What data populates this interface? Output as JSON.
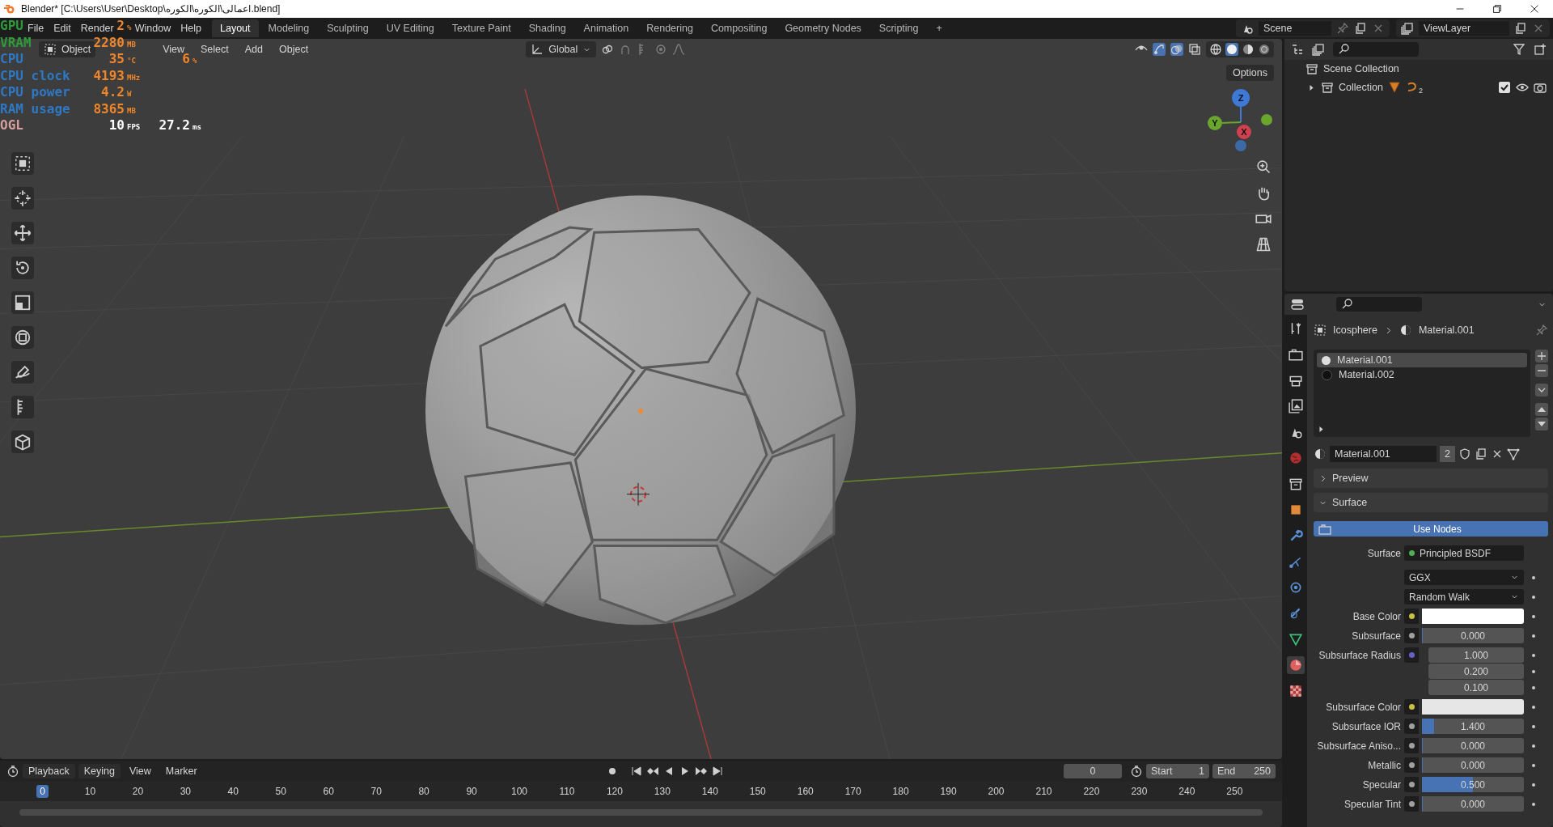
{
  "window": {
    "title": "Blender* [C:\\Users\\User\\Desktop\\اعمالى\\الكوره\\الكوره.blend]"
  },
  "menu": [
    "File",
    "Edit",
    "Render",
    "Window",
    "Help"
  ],
  "workspaces": [
    {
      "label": "Layout",
      "selected": true
    },
    {
      "label": "Modeling",
      "selected": false
    },
    {
      "label": "Sculpting",
      "selected": false
    },
    {
      "label": "UV Editing",
      "selected": false
    },
    {
      "label": "Texture Paint",
      "selected": false
    },
    {
      "label": "Shading",
      "selected": false
    },
    {
      "label": "Animation",
      "selected": false
    },
    {
      "label": "Rendering",
      "selected": false
    },
    {
      "label": "Compositing",
      "selected": false
    },
    {
      "label": "Geometry Nodes",
      "selected": false
    },
    {
      "label": "Scripting",
      "selected": false
    }
  ],
  "add_workspace": "+",
  "scene": "Scene",
  "view_layer": "ViewLayer",
  "viewport": {
    "mode": "Object",
    "menus": [
      "View",
      "Select",
      "Add",
      "Object"
    ],
    "orientation": "Global",
    "options": "Options",
    "gizmo": [
      {
        "label": "Z",
        "color": "#3d7ad6"
      },
      {
        "label": "Y",
        "color": "#6aa52e"
      },
      {
        "label": "X",
        "color": "#d0404e"
      }
    ]
  },
  "hud": [
    {
      "kind": "sensor",
      "label": "GPU",
      "color": "#2e9a3a",
      "value": "2",
      "unit": "%"
    },
    {
      "kind": "sensor",
      "label": "VRAM",
      "color": "#2e9a3a",
      "value": "2280",
      "unit": "MB"
    },
    {
      "kind": "sensor",
      "label": "CPU",
      "color": "#2f78c4",
      "value": "35",
      "unit": "°C",
      "extra": "6",
      "extra_unit": "%"
    },
    {
      "kind": "sensor",
      "label": "CPU clock",
      "color": "#2f78c4",
      "value": "4193",
      "unit": "MHz"
    },
    {
      "kind": "sensor",
      "label": "CPU power",
      "color": "#2f78c4",
      "value": "4.2",
      "unit": "W"
    },
    {
      "kind": "sensor",
      "label": "RAM usage",
      "color": "#2f78c4",
      "value": "8365",
      "unit": "MB"
    },
    {
      "kind": "frames",
      "label": "OGL",
      "color": "#d8a0a0",
      "value": "10",
      "unit": "FPS",
      "extra": "27.2",
      "extra_unit": "ms"
    }
  ],
  "outliner": {
    "root": {
      "label": "Scene Collection",
      "children": [
        {
          "label": "Collection",
          "expanded": false,
          "count": "2",
          "checked": true
        }
      ]
    }
  },
  "properties": {
    "breadcrumb": [
      "Icosphere",
      "Material.001"
    ],
    "slots": [
      {
        "name": "Material.001",
        "selected": true
      },
      {
        "name": "Material.002",
        "selected": false
      }
    ],
    "material": "Material.001",
    "users": "2",
    "panels": [
      {
        "label": "Preview",
        "expanded": false
      },
      {
        "label": "Surface",
        "expanded": true
      }
    ],
    "use_nodes": "Use Nodes",
    "fields": [
      {
        "kind": "link",
        "label": "Surface",
        "value": "Principled BSDF"
      },
      {
        "kind": "dropdown",
        "value": "GGX"
      },
      {
        "kind": "dropdown",
        "value": "Random Walk"
      },
      {
        "kind": "color",
        "label": "Base Color",
        "color": "#ffffff"
      },
      {
        "kind": "number",
        "label": "Subsurface",
        "value": "0.000",
        "level": 0
      },
      {
        "kind": "vector",
        "label": "Subsurface Radius",
        "values": [
          "1.000",
          "0.200",
          "0.100"
        ]
      },
      {
        "kind": "color",
        "label": "Subsurface Color",
        "color": "#e6e6e6"
      },
      {
        "kind": "number",
        "label": "Subsurface IOR",
        "value": "1.400",
        "level": 0.12
      },
      {
        "kind": "number",
        "label": "Subsurface Aniso...",
        "value": "0.000",
        "level": 0
      },
      {
        "kind": "number",
        "label": "Metallic",
        "value": "0.000",
        "level": 0
      },
      {
        "kind": "number",
        "label": "Specular",
        "value": "0.500",
        "level": 0.5
      },
      {
        "kind": "number",
        "label": "Specular Tint",
        "value": "0.000",
        "level": 0
      }
    ]
  },
  "timeline": {
    "menus": [
      "Playback",
      "Keying",
      "View",
      "Marker"
    ],
    "current_frame": "0",
    "start_label": "Start",
    "start": "1",
    "end_label": "End",
    "end": "250",
    "ticks": [
      {
        "label": "0",
        "selected": true
      },
      {
        "label": "10",
        "selected": false
      },
      {
        "label": "20",
        "selected": false
      },
      {
        "label": "30",
        "selected": false
      },
      {
        "label": "40",
        "selected": false
      },
      {
        "label": "50",
        "selected": false
      },
      {
        "label": "60",
        "selected": false
      },
      {
        "label": "70",
        "selected": false
      },
      {
        "label": "80",
        "selected": false
      },
      {
        "label": "90",
        "selected": false
      },
      {
        "label": "100",
        "selected": false
      },
      {
        "label": "110",
        "selected": false
      },
      {
        "label": "120",
        "selected": false
      },
      {
        "label": "130",
        "selected": false
      },
      {
        "label": "140",
        "selected": false
      },
      {
        "label": "150",
        "selected": false
      },
      {
        "label": "160",
        "selected": false
      },
      {
        "label": "170",
        "selected": false
      },
      {
        "label": "180",
        "selected": false
      },
      {
        "label": "190",
        "selected": false
      },
      {
        "label": "200",
        "selected": false
      },
      {
        "label": "210",
        "selected": false
      },
      {
        "label": "220",
        "selected": false
      },
      {
        "label": "230",
        "selected": false
      },
      {
        "label": "240",
        "selected": false
      },
      {
        "label": "250",
        "selected": false
      }
    ]
  }
}
